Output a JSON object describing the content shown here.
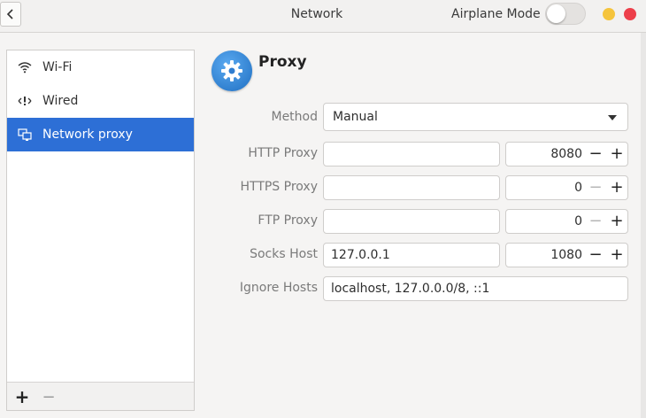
{
  "window": {
    "title": "Network",
    "airplane_mode_label": "Airplane Mode",
    "airplane_mode_on": false
  },
  "sidebar": {
    "items": [
      {
        "label": "Wi-Fi",
        "icon": "wifi-icon",
        "active": false
      },
      {
        "label": "Wired",
        "icon": "wired-icon",
        "active": false
      },
      {
        "label": "Network proxy",
        "icon": "network-proxy-icon",
        "active": true
      }
    ],
    "add_label": "+",
    "remove_label": "−"
  },
  "proxy": {
    "title": "Proxy",
    "method_label": "Method",
    "method_value": "Manual",
    "rows": [
      {
        "label": "HTTP Proxy",
        "host": "",
        "port": "8080",
        "minus_enabled": true
      },
      {
        "label": "HTTPS Proxy",
        "host": "",
        "port": "0",
        "minus_enabled": false
      },
      {
        "label": "FTP Proxy",
        "host": "",
        "port": "0",
        "minus_enabled": false
      },
      {
        "label": "Socks Host",
        "host": "127.0.0.1",
        "port": "1080",
        "minus_enabled": true
      }
    ],
    "ignore_hosts_label": "Ignore Hosts",
    "ignore_hosts_value": "localhost, 127.0.0.0/8, ::1",
    "spin_minus": "−",
    "spin_plus": "+"
  },
  "colors": {
    "accent": "#2d6fd6",
    "minimize": "#f5c43c",
    "close": "#ed3f4a"
  }
}
